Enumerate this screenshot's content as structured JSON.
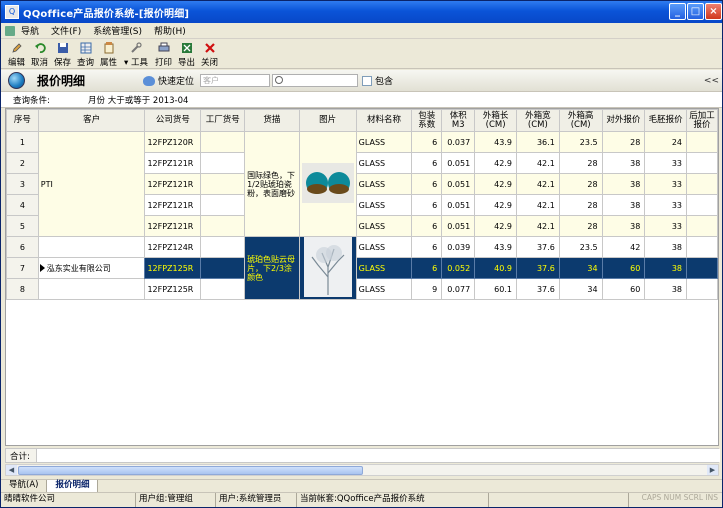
{
  "window": {
    "title": "QQoffice产品报价系统-[报价明细]"
  },
  "menu": {
    "items": [
      "导航",
      "文件(F)",
      "系统管理(S)",
      "帮助(H)"
    ]
  },
  "toolbar": {
    "items": [
      "编辑",
      "取消",
      "保存",
      "查询",
      "属性",
      "工具",
      "打印",
      "导出",
      "关闭"
    ]
  },
  "header": {
    "title": "报价明细",
    "quick_locate": "快速定位",
    "customer_placeholder": "客户",
    "search_value": "",
    "contains_label": "包含"
  },
  "query": {
    "label": "查询条件:",
    "condition": "月份  大于或等于  2013-04"
  },
  "table": {
    "headers": [
      "序号",
      "客户",
      "公司货号",
      "工厂货号",
      "货描",
      "图片",
      "材料名称",
      "包装系数",
      "体积M3",
      "外箱长(CM)",
      "外箱宽(CM)",
      "外箱高(CM)",
      "对外报价",
      "毛胚报价",
      "后加工报价"
    ],
    "rows": [
      {
        "no": "1",
        "customer": "",
        "sku": "12FPZ120R",
        "factory": "",
        "material": "GLASS",
        "pack": "6",
        "vol": "0.037",
        "l": "43.9",
        "w": "36.1",
        "h": "23.5",
        "ext": "28",
        "blank": "24"
      },
      {
        "no": "2",
        "customer": "",
        "sku": "12FPZ121R",
        "factory": "",
        "material": "GLASS",
        "pack": "6",
        "vol": "0.051",
        "l": "42.9",
        "w": "42.1",
        "h": "28",
        "ext": "38",
        "blank": "33"
      },
      {
        "no": "3",
        "customer": "PTI",
        "sku": "12FPZ121R",
        "factory": "",
        "material": "GLASS",
        "pack": "6",
        "vol": "0.051",
        "l": "42.9",
        "w": "42.1",
        "h": "28",
        "ext": "38",
        "blank": "33"
      },
      {
        "no": "4",
        "customer": "",
        "sku": "12FPZ121R",
        "factory": "",
        "material": "GLASS",
        "pack": "6",
        "vol": "0.051",
        "l": "42.9",
        "w": "42.1",
        "h": "28",
        "ext": "38",
        "blank": "33"
      },
      {
        "no": "5",
        "customer": "",
        "sku": "12FPZ121R",
        "factory": "",
        "material": "GLASS",
        "pack": "6",
        "vol": "0.051",
        "l": "42.9",
        "w": "42.1",
        "h": "28",
        "ext": "38",
        "blank": "33"
      },
      {
        "no": "6",
        "customer": "",
        "sku": "12FPZ124R",
        "factory": "",
        "material": "GLASS",
        "pack": "6",
        "vol": "0.039",
        "l": "43.9",
        "w": "37.6",
        "h": "23.5",
        "ext": "42",
        "blank": "38"
      },
      {
        "no": "7",
        "customer": "泓东实业有限公司",
        "sku": "12FPZ125R",
        "factory": "",
        "material": "GLASS",
        "pack": "6",
        "vol": "0.052",
        "l": "40.9",
        "w": "37.6",
        "h": "34",
        "ext": "60",
        "blank": "38"
      },
      {
        "no": "8",
        "customer": "",
        "sku": "12FPZ125R",
        "factory": "",
        "material": "GLASS",
        "pack": "9",
        "vol": "0.077",
        "l": "60.1",
        "w": "37.6",
        "h": "34",
        "ext": "60",
        "blank": "38"
      }
    ],
    "desc_group1": "国际绿色，下1/2贴琥珀瓷粉，表面磨砂",
    "desc_group2": "琥珀色贴云母片，下2/3涂颜色"
  },
  "summary": {
    "label": "合计:"
  },
  "tabs": {
    "items": [
      "导航(A)",
      "报价明细"
    ]
  },
  "status": {
    "company": "晴晴软件公司",
    "group": "用户组:管理组",
    "user": "用户:系统管理员",
    "account": "当前帐套:QQoffice产品报价系统",
    "keys": "CAPS NUM SCRL INS"
  }
}
